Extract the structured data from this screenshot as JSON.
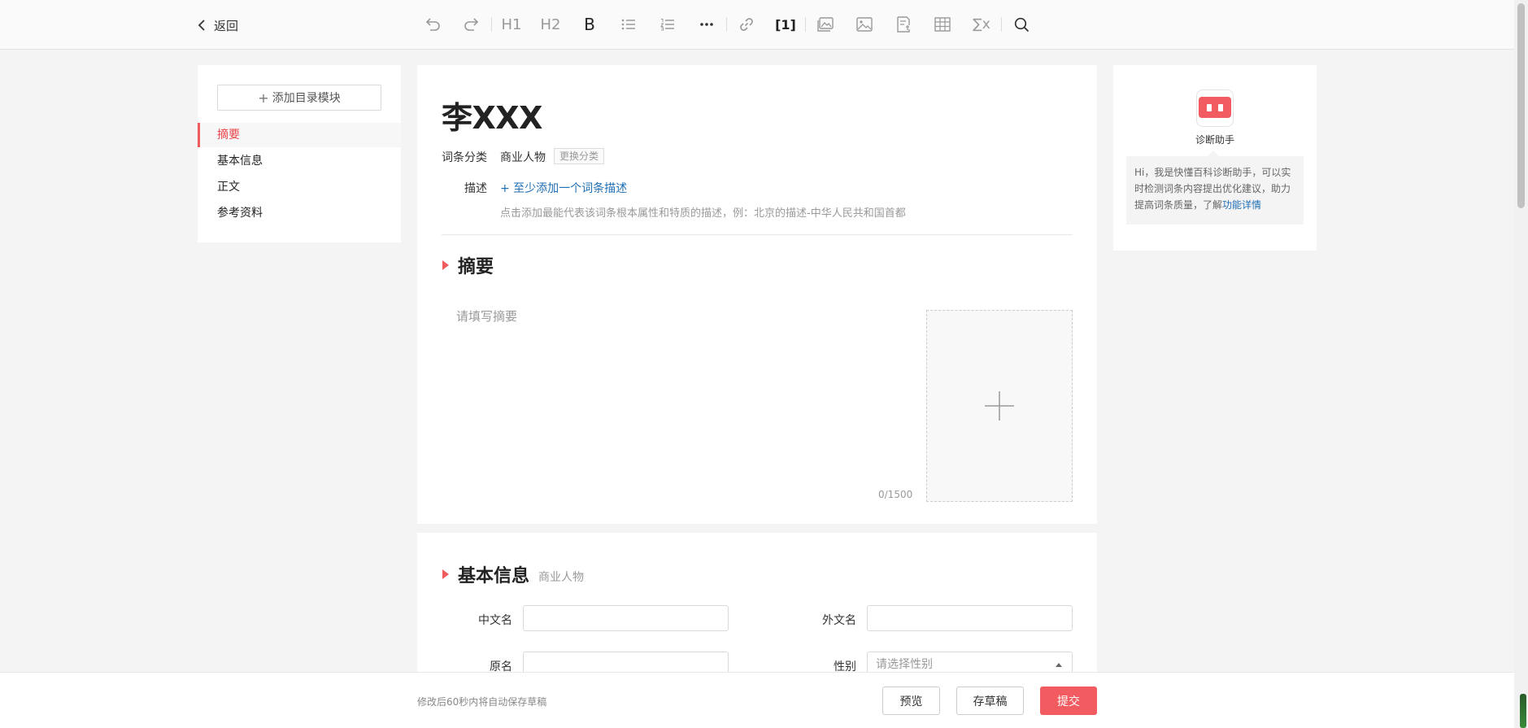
{
  "toolbar": {
    "back_label": "返回",
    "tools": [
      "undo-icon",
      "redo-icon",
      "heading1-icon",
      "heading2-icon",
      "bold-icon",
      "bullet-list-icon",
      "numbered-list-icon",
      "more-icon",
      "link-icon",
      "reference-icon",
      "image-gallery-icon",
      "image-icon",
      "template-icon",
      "table-icon",
      "formula-icon",
      "search-icon"
    ],
    "h1": "H1",
    "h2": "H2",
    "bold": "B",
    "ref": "[1]",
    "formula": "∑x"
  },
  "outline": {
    "add_module": "添加目录模块",
    "items": [
      {
        "label": "摘要",
        "active": true
      },
      {
        "label": "基本信息",
        "active": false
      },
      {
        "label": "正文",
        "active": false
      },
      {
        "label": "参考资料",
        "active": false
      }
    ]
  },
  "entry": {
    "title": "李XXX",
    "category_label": "词条分类",
    "category_value": "商业人物",
    "change_category": "更换分类",
    "desc_label": "描述",
    "desc_add": "+ 至少添加一个词条描述",
    "desc_hint": "点击添加最能代表该词条根本属性和特质的描述，例：北京的描述-中华人民共和国首都"
  },
  "summary": {
    "title": "摘要",
    "placeholder": "请填写摘要",
    "counter": "0/1500"
  },
  "basic_info": {
    "title": "基本信息",
    "subtitle": "商业人物",
    "fields": {
      "chinese_name": "中文名",
      "foreign_name": "外文名",
      "original_name": "原名",
      "gender": "性别",
      "gender_placeholder": "请选择性别"
    }
  },
  "assistant": {
    "name": "诊断助手",
    "message": "Hi，我是快懂百科诊断助手，可以实时检测词条内容提出优化建议，助力提高词条质量，了解",
    "link": "功能详情"
  },
  "footer": {
    "autosave": "修改后60秒内将自动保存草稿",
    "preview": "预览",
    "save_draft": "存草稿",
    "submit": "提交"
  },
  "colors": {
    "accent": "#f25b5f",
    "link": "#1f6fb5"
  }
}
